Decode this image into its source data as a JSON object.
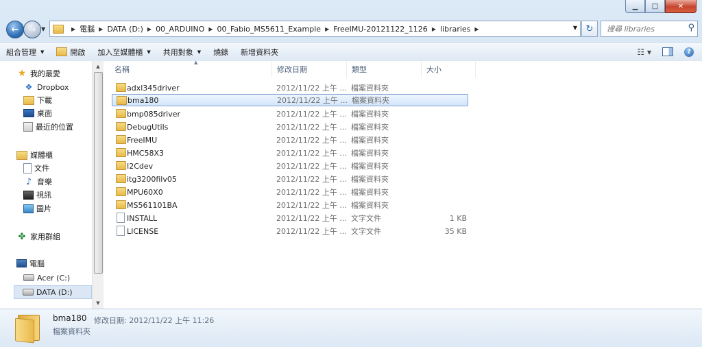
{
  "window": {
    "caption": {
      "minimize": "▁",
      "maximize": "□",
      "close": "✕"
    }
  },
  "address": {
    "crumbs": [
      "電腦",
      "DATA (D:)",
      "00_ARDUINO",
      "00_Fabio_MS5611_Example",
      "FreeIMU-20121122_1126",
      "libraries"
    ],
    "search_placeholder": "搜尋 libraries"
  },
  "toolbar": {
    "organize": "組合管理",
    "open": "開啟",
    "add_to_library": "加入至媒體櫃",
    "share": "共用對象",
    "burn": "燒錄",
    "new_folder": "新增資料夾"
  },
  "nav": {
    "favorites": "我的最愛",
    "dropbox": "Dropbox",
    "downloads": "下載",
    "desktop": "桌面",
    "recent": "最近的位置",
    "libraries": "媒體櫃",
    "documents": "文件",
    "music": "音樂",
    "videos": "視訊",
    "pictures": "圖片",
    "homegroup": "家用群組",
    "computer": "電腦",
    "drive_c": "Acer (C:)",
    "drive_d": "DATA (D:)"
  },
  "columns": {
    "name": "名稱",
    "date": "修改日期",
    "type": "類型",
    "size": "大小"
  },
  "files": [
    {
      "name": "adxl345driver",
      "date": "2012/11/22 上午 ...",
      "type": "檔案資料夾",
      "size": ""
    },
    {
      "name": "bma180",
      "date": "2012/11/22 上午 ...",
      "type": "檔案資料夾",
      "size": ""
    },
    {
      "name": "bmp085driver",
      "date": "2012/11/22 上午 ...",
      "type": "檔案資料夾",
      "size": ""
    },
    {
      "name": "DebugUtils",
      "date": "2012/11/22 上午 ...",
      "type": "檔案資料夾",
      "size": ""
    },
    {
      "name": "FreeIMU",
      "date": "2012/11/22 上午 ...",
      "type": "檔案資料夾",
      "size": ""
    },
    {
      "name": "HMC58X3",
      "date": "2012/11/22 上午 ...",
      "type": "檔案資料夾",
      "size": ""
    },
    {
      "name": "I2Cdev",
      "date": "2012/11/22 上午 ...",
      "type": "檔案資料夾",
      "size": ""
    },
    {
      "name": "itg3200filv05",
      "date": "2012/11/22 上午 ...",
      "type": "檔案資料夾",
      "size": ""
    },
    {
      "name": "MPU60X0",
      "date": "2012/11/22 上午 ...",
      "type": "檔案資料夾",
      "size": ""
    },
    {
      "name": "MS561101BA",
      "date": "2012/11/22 上午 ...",
      "type": "檔案資料夾",
      "size": ""
    },
    {
      "name": "INSTALL",
      "date": "2012/11/22 上午 ...",
      "type": "文字文件",
      "size": "1 KB"
    },
    {
      "name": "LICENSE",
      "date": "2012/11/22 上午 ...",
      "type": "文字文件",
      "size": "35 KB"
    }
  ],
  "details": {
    "name": "bma180",
    "modified": "修改日期: 2012/11/22 上午 11:26",
    "type": "檔案資料夾"
  }
}
